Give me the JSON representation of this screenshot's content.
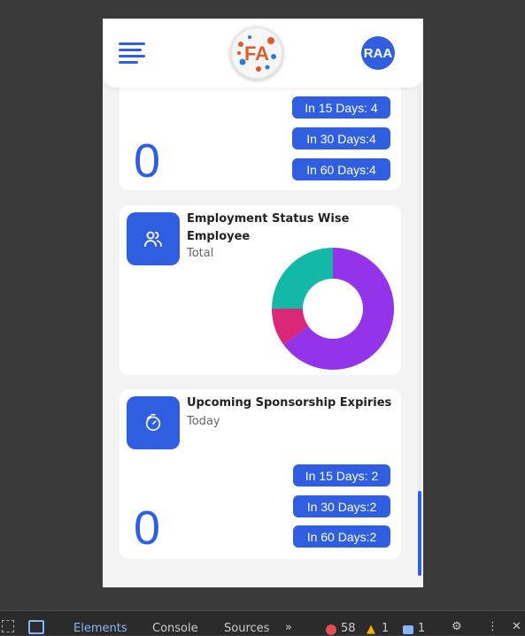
{
  "header": {
    "avatar_initials": "RAA",
    "logo_text": "FA",
    "brand_color": "#2f5fe0"
  },
  "top_card": {
    "count": "0",
    "badges": [
      "In 15 Days: 4",
      "In 30 Days:4",
      "In 60 Days:4"
    ]
  },
  "employment_card": {
    "title_line1": "Employment Status Wise",
    "title_line2": "Employee",
    "subtitle": "Total",
    "icon": "users-icon"
  },
  "chart_data": {
    "type": "pie",
    "donut": true,
    "slices": [
      {
        "value": 65,
        "color": "#9333ea"
      },
      {
        "value": 10,
        "color": "#db2777"
      },
      {
        "value": 25,
        "color": "#14b8a6"
      }
    ]
  },
  "sponsorship_card": {
    "title": "Upcoming Sponsorship Expiries",
    "subtitle": "Today",
    "icon": "timer-icon",
    "count": "0",
    "badges": [
      "In 15 Days: 2",
      "In 30 Days:2",
      "In 60 Days:2"
    ]
  },
  "devtools": {
    "tabs": [
      "Elements",
      "Console",
      "Sources"
    ],
    "error_count": "58",
    "warning_count": "1",
    "info_count": "1"
  }
}
